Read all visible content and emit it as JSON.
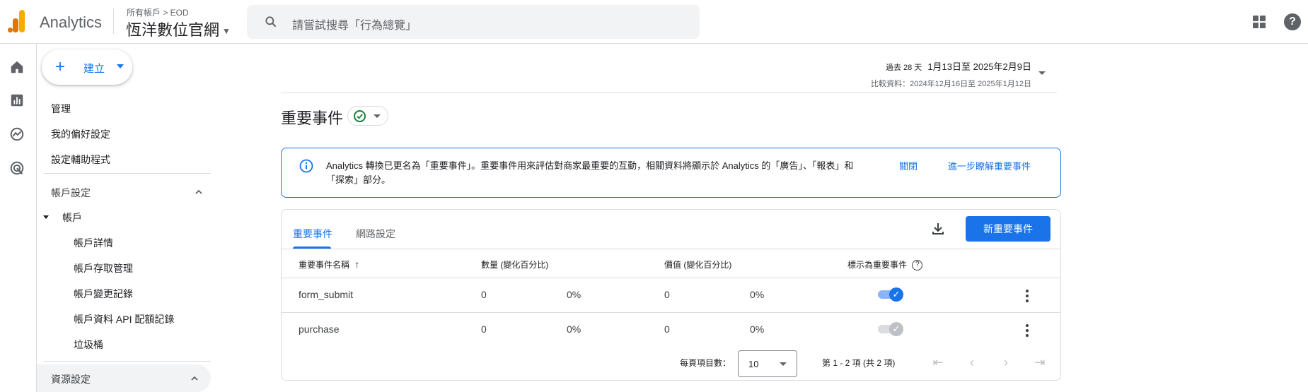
{
  "app": {
    "name": "Analytics",
    "breadcrumb": "所有帳戶 > EOD",
    "property": "恆洋數位官網",
    "search_placeholder": "請嘗試搜尋「行為總覽」"
  },
  "icons": {
    "rail": [
      "home-icon",
      "reports-icon",
      "explore-icon",
      "advertising-icon"
    ],
    "apps": "apps-grid-icon",
    "help": "help-icon"
  },
  "create_button": {
    "label": "建立"
  },
  "sidebar": {
    "items": [
      "管理",
      "我的偏好設定",
      "設定輔助程式"
    ],
    "account_settings": "帳戶設定",
    "account": "帳戶",
    "account_items": [
      "帳戶詳情",
      "帳戶存取管理",
      "帳戶變更記錄",
      "帳戶資料 API 配額記錄",
      "垃圾桶"
    ],
    "property_settings": "資源設定"
  },
  "date_range": {
    "prefix": "過去 28 天",
    "range": "1月13日至 2025年2月9日",
    "compare": "比較資料：2024年12月16日至 2025年1月12日"
  },
  "page": {
    "title": "重要事件"
  },
  "banner": {
    "message": "Analytics 轉換已更名為「重要事件」。重要事件用來評估對商家最重要的互動，相關資料將顯示於 Analytics 的「廣告」、「報表」和「探索」部分。",
    "close": "關閉",
    "learn_more": "進一步瞭解重要事件"
  },
  "tabs": [
    "重要事件",
    "網路設定"
  ],
  "new_button": "新重要事件",
  "table": {
    "headers": [
      "重要事件名稱",
      "數量 (變化百分比)",
      "價值 (變化百分比)",
      "標示為重要事件"
    ],
    "rows": [
      {
        "name": "form_submit",
        "count": "0",
        "count_change": "0%",
        "value": "0",
        "value_change": "0%",
        "marked": true
      },
      {
        "name": "purchase",
        "count": "0",
        "count_change": "0%",
        "value": "0",
        "value_change": "0%",
        "marked": false
      }
    ]
  },
  "pagination": {
    "per_page_label": "每頁項目數：",
    "per_page": "10",
    "range": "第 1 - 2 項 (共 2 項)"
  },
  "colors": {
    "accent": "#1a73e8",
    "success": "#188038"
  }
}
